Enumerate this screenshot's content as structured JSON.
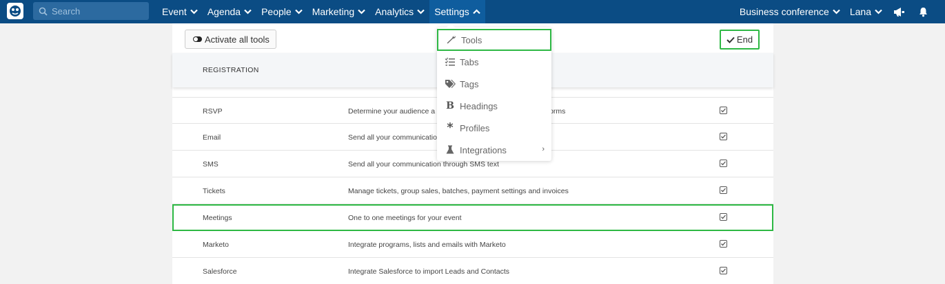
{
  "topbar": {
    "search_placeholder": "Search",
    "nav_left": [
      "Event",
      "Agenda",
      "People",
      "Marketing",
      "Analytics",
      "Settings"
    ],
    "nav_right": [
      "Business conference",
      "Lana"
    ],
    "active_nav": "Settings",
    "bg_color": "#0b4c84"
  },
  "toolbar": {
    "activate_label": "Activate all tools",
    "end_label": "End"
  },
  "section": {
    "title": "REGISTRATION"
  },
  "rows": [
    {
      "name": "RSVP",
      "description": "Determine your audience a",
      "description_tail": "orms"
    },
    {
      "name": "Email",
      "description": "Send all your communicatio",
      "description_tail": ""
    },
    {
      "name": "SMS",
      "description": "Send all your communication through SMS text",
      "description_tail": ""
    },
    {
      "name": "Tickets",
      "description": "Manage tickets, group sales, batches, payment settings and invoices",
      "description_tail": ""
    },
    {
      "name": "Meetings",
      "description": "One to one meetings for your event",
      "description_tail": ""
    },
    {
      "name": "Marketo",
      "description": "Integrate programs, lists and emails with Marketo",
      "description_tail": ""
    },
    {
      "name": "Salesforce",
      "description": "Integrate Salesforce to import Leads and Contacts",
      "description_tail": ""
    }
  ],
  "settings_menu": {
    "items": [
      {
        "label": "Tools",
        "icon": "wrench-icon"
      },
      {
        "label": "Tabs",
        "icon": "list-icon"
      },
      {
        "label": "Tags",
        "icon": "tags-icon"
      },
      {
        "label": "Headings",
        "icon": "bold-icon"
      },
      {
        "label": "Profiles",
        "icon": "asterisk-icon"
      },
      {
        "label": "Integrations",
        "icon": "flask-icon"
      }
    ],
    "submenu_arrow": "›"
  },
  "highlight_color": "#2db843"
}
